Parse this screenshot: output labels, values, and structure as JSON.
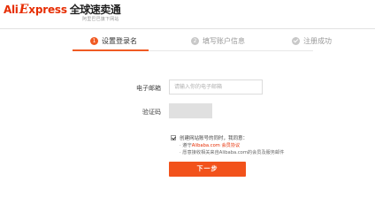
{
  "header": {
    "logo_ali": "Ali",
    "logo_e": "E",
    "logo_xpress": "xpress",
    "logo_cn": "全球速卖通",
    "tagline": "阿里巴巴旗下网站"
  },
  "steps": [
    {
      "number": "1",
      "label": "设置登录名",
      "state": "active"
    },
    {
      "number": "2",
      "label": "填写账户信息",
      "state": "inactive"
    },
    {
      "number": "",
      "label": "注册成功",
      "state": "inactive"
    }
  ],
  "form": {
    "email_label": "电子邮箱",
    "email_placeholder": "请输入你的电子邮箱",
    "captcha_label": "验证码"
  },
  "agreement": {
    "checked": true,
    "main_text": "创建网站账号的同时，我同意：",
    "bullet1_prefix": "· 遵守",
    "bullet1_link": "Alibaba.com 会员协议",
    "bullet2": "· 愿意接收相关来自Alibaba.com的会员及服务邮件"
  },
  "next_button": "下一步",
  "colors": {
    "accent": "#f05a23",
    "brand_red": "#e62e04",
    "inactive": "#c8c8c8"
  }
}
